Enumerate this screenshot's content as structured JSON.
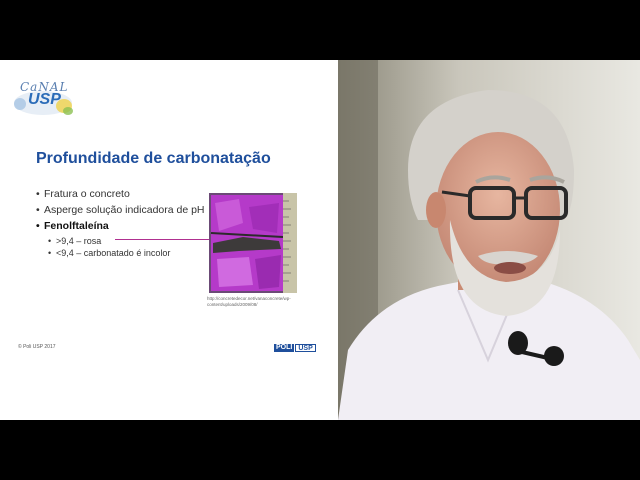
{
  "slide": {
    "logo_top": "CaNAL",
    "logo_bottom": "USP",
    "title": "Profundidade de carbonatação",
    "bullets": [
      "Fratura o concreto",
      "Asperge solução indicadora de pH",
      "Fenolftaleína"
    ],
    "sub_bullets": [
      ">9,4 – rosa",
      "<9,4 – carbonatado é incolor"
    ],
    "caption": "http://concretedecor.net/vanaconcrete/wp-content/uploads/2009/08/",
    "footer_copyright": "© Poli USP 2017",
    "footer_logo_poli": "POLI",
    "footer_logo_usp": "USP"
  },
  "colors": {
    "title": "#1f4f9c",
    "pointer": "#b03090",
    "phenolphthalein_pink": "#b53ac9",
    "background_slide": "#ffffff",
    "letterbox": "#000000"
  },
  "icons": [
    "canal-usp-logo",
    "concrete-sample-photo",
    "poli-usp-logo",
    "lapel-microphone-icon"
  ]
}
